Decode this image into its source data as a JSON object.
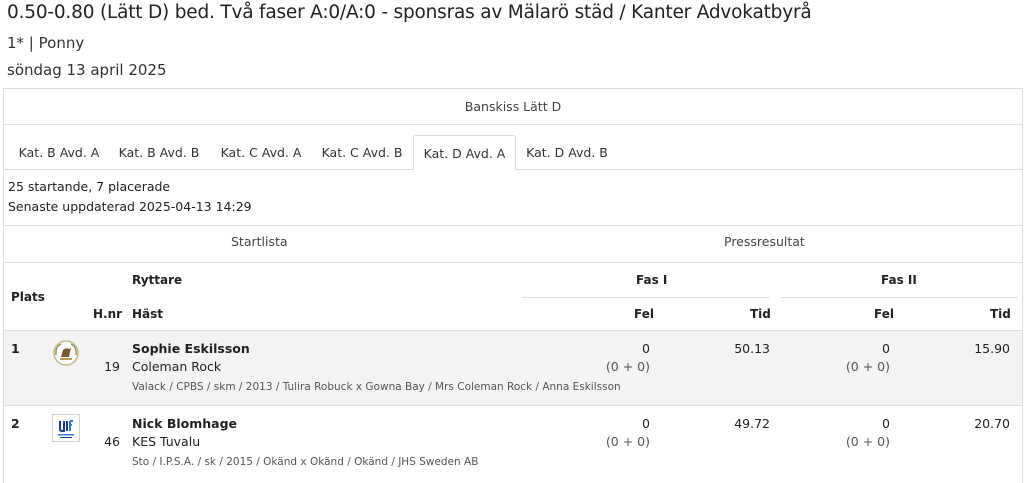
{
  "header": {
    "title": "0.50-0.80 (Lätt D) bed. Två faser A:0/A:0 - sponsras av Mälarö städ / Kanter Advokatbyrå",
    "level": "1* | Ponny",
    "date": "söndag 13 april 2025"
  },
  "class_name": "Banskiss Lätt D",
  "tabs": [
    {
      "label": "Kat. B Avd. A",
      "active": false
    },
    {
      "label": "Kat. B Avd. B",
      "active": false
    },
    {
      "label": "Kat. C Avd. A",
      "active": false
    },
    {
      "label": "Kat. C Avd. B",
      "active": false
    },
    {
      "label": "Kat. D Avd. A",
      "active": true
    },
    {
      "label": "Kat. D Avd. B",
      "active": false
    }
  ],
  "info": {
    "starters": "25 startande, 7 placerade",
    "updated": "Senaste uppdaterad 2025-04-13 14:29"
  },
  "sections": {
    "startlist": "Startlista",
    "press": "Pressresultat"
  },
  "table": {
    "headers": {
      "plats": "Plats",
      "hnr": "H.nr",
      "rider": "Ryttare",
      "horse": "Häst",
      "phase1": "Fas I",
      "phase2": "Fas II",
      "faults": "Fel",
      "time": "Tid"
    },
    "rows": [
      {
        "place": "1",
        "logo": "club-logo-horse-crest",
        "hnr": "19",
        "rider": "Sophie Eskilsson",
        "horse": "Coleman Rock",
        "details": "Valack / CPBS / skm / 2013 / Tulira Robuck x Gowna Bay / Mrs Coleman Rock / Anna Eskilsson",
        "p1_faults": "0",
        "p1_breakdown": "(0 + 0)",
        "p1_time": "50.13",
        "p2_faults": "0",
        "p2_breakdown": "(0 + 0)",
        "p2_time": "15.90"
      },
      {
        "place": "2",
        "logo": "club-logo-blue-wave",
        "hnr": "46",
        "rider": "Nick Blomhage",
        "horse": "KES Tuvalu",
        "details": "Sto / I.P.S.A. / sk / 2015 / Okänd x Okänd / Okänd / JHS Sweden AB",
        "p1_faults": "0",
        "p1_breakdown": "(0 + 0)",
        "p1_time": "49.72",
        "p2_faults": "0",
        "p2_breakdown": "(0 + 0)",
        "p2_time": "20.70"
      }
    ]
  }
}
